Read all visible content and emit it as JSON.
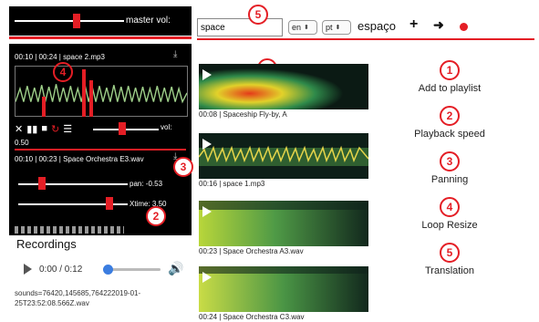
{
  "master": {
    "label": "master vol:",
    "level": 0.55
  },
  "search": {
    "value": "space",
    "placeholder": ""
  },
  "lang": {
    "from": "en",
    "to": "pt",
    "arrows": "⬍"
  },
  "translation": "espaço",
  "toolbar": {
    "add_icon": "+",
    "go_icon": "➜"
  },
  "player1": {
    "file": "00:10 | 00:24 | space 2.mp3",
    "controls": [
      "✕",
      "▮▮",
      "■",
      "↻",
      "☰"
    ],
    "vol_label": "vol:",
    "vol_value": "0.50",
    "download_icon": "⤓"
  },
  "player2": {
    "file": "00:10 | 00:23 | Space Orchestra E3.wav",
    "pan_label": "pan: -0.53",
    "xtime_label": "Xtime: 3.50",
    "download_icon": "⤓"
  },
  "recordings": {
    "title": "Recordings",
    "time": "0:00 / 0:12",
    "speaker_icon": "🔊",
    "sounds": "sounds=76420,145685,764222019-01-25T23:52:08.566Z.wav"
  },
  "playlist": [
    {
      "caption": "00:08 | Spaceship Fly-by, A"
    },
    {
      "caption": "00:16 | space 1.mp3"
    },
    {
      "caption": "00:23 | Space Orchestra A3.wav"
    },
    {
      "caption": "00:24 | Space Orchestra C3.wav"
    }
  ],
  "callouts": [
    "1",
    "2",
    "3",
    "4",
    "5"
  ],
  "legend": [
    {
      "num": "1",
      "text": "Add to playlist"
    },
    {
      "num": "2",
      "text": "Playback speed"
    },
    {
      "num": "3",
      "text": "Panning"
    },
    {
      "num": "4",
      "text": "Loop Resize"
    },
    {
      "num": "5",
      "text": "Translation"
    }
  ],
  "colors": {
    "accent": "#e41e25",
    "panel": "#000000",
    "progress": "#3b7de0"
  }
}
